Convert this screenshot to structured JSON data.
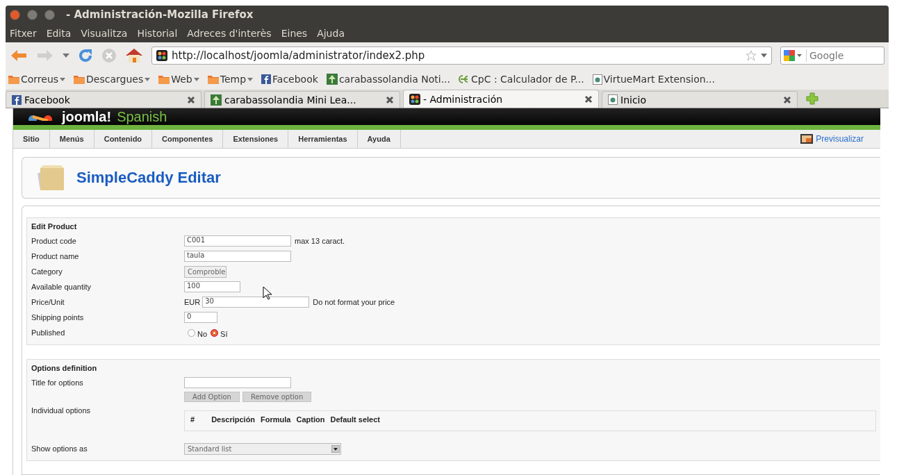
{
  "window": {
    "title": "- Administración-Mozilla Firefox"
  },
  "menu": [
    "Fitxer",
    "Edita",
    "Visualitza",
    "Historial",
    "Adreces d'interès",
    "Eines",
    "Ajuda"
  ],
  "url": "http://localhost/joomla/administrator/index2.php",
  "search": {
    "placeholder": "Google"
  },
  "bookmarks": [
    {
      "label": "Correus",
      "kind": "folder"
    },
    {
      "label": "Descargues",
      "kind": "folder"
    },
    {
      "label": "Web",
      "kind": "folder"
    },
    {
      "label": "Temp",
      "kind": "folder"
    },
    {
      "label": "Facebook",
      "kind": "facebook"
    },
    {
      "label": "carabassolandia Noti...",
      "kind": "tree"
    },
    {
      "label": "CpC : Calculador de P...",
      "kind": "cpc"
    },
    {
      "label": "VirtueMart Extension...",
      "kind": "page"
    }
  ],
  "tabs": [
    {
      "label": "Facebook",
      "kind": "facebook",
      "selected": false
    },
    {
      "label": "carabassolandia Mini Lea...",
      "kind": "tree",
      "selected": false
    },
    {
      "label": "- Administración",
      "kind": "joomla",
      "selected": true
    },
    {
      "label": "Inicio",
      "kind": "page",
      "selected": false
    }
  ],
  "site": {
    "logo": "joomla!",
    "logo_sub": "Spanish",
    "nav": [
      "Sitio",
      "Menús",
      "Contenido",
      "Componentes",
      "Extensiones",
      "Herramientas",
      "Ayuda"
    ],
    "preview": "Previsualizar",
    "heading": "SimpleCaddy Editar"
  },
  "product": {
    "title": "Edit Product",
    "fields": [
      {
        "label": "Product code",
        "kind": "text",
        "value": "C001",
        "note": "max 13 caract."
      },
      {
        "label": "Product name",
        "kind": "text",
        "value": "taula"
      },
      {
        "label": "Category",
        "kind": "select",
        "value": "Comproble"
      },
      {
        "label": "Available quantity",
        "kind": "text",
        "value": "100"
      },
      {
        "label": "Price/Unit",
        "kind": "currency",
        "prefix": "EUR",
        "value": "30",
        "note": "Do not format your price"
      },
      {
        "label": "Shipping points",
        "kind": "text",
        "value": "0"
      },
      {
        "label": "Published",
        "kind": "radio",
        "options": [
          {
            "label": "No",
            "selected": false
          },
          {
            "label": "Sí",
            "selected": true
          }
        ]
      }
    ]
  },
  "options": {
    "title": "Options definition",
    "title_label": "Title for options",
    "buttons": [
      "Add Option",
      "Remove option"
    ],
    "individual_label": "Individual options",
    "columns": [
      "#",
      "Descripción",
      "Formula",
      "Caption",
      "Default select"
    ],
    "show_label": "Show options as",
    "show_value": "Standard list"
  }
}
